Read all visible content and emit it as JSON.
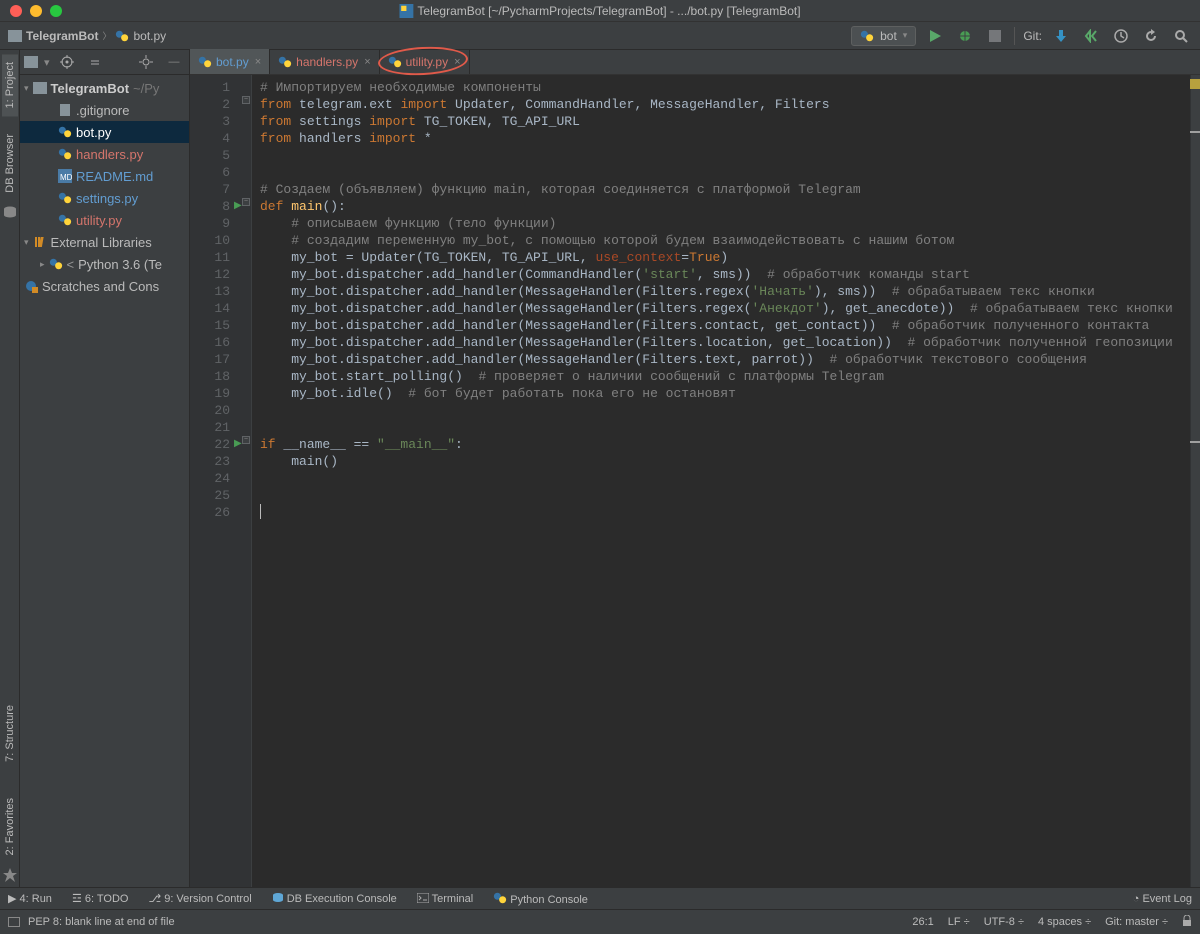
{
  "window": {
    "title": "TelegramBot [~/PycharmProjects/TelegramBot] - .../bot.py [TelegramBot]"
  },
  "breadcrumbs": {
    "project": "TelegramBot",
    "file": "bot.py"
  },
  "toolbar": {
    "run_config": "bot",
    "git_label": "Git:"
  },
  "left_gutter": {
    "tab_project": "1: Project",
    "tab_db_browser": "DB Browser",
    "tab_structure": "7: Structure",
    "tab_favorites": "2: Favorites"
  },
  "project_panel": {
    "header_icon_tip": "Project",
    "root_name": "TelegramBot",
    "root_path": "~/Py",
    "files": [
      {
        "name": ".gitignore",
        "type": "file",
        "modified": false
      },
      {
        "name": "bot.py",
        "type": "py",
        "modified": true,
        "selected": true
      },
      {
        "name": "handlers.py",
        "type": "py",
        "conflict": true
      },
      {
        "name": "README.md",
        "type": "md",
        "modified": true
      },
      {
        "name": "settings.py",
        "type": "py",
        "modified": true
      },
      {
        "name": "utility.py",
        "type": "py",
        "conflict": true
      }
    ],
    "external_libs": "External Libraries",
    "python_env": "Python 3.6 (Te",
    "scratches": "Scratches and Cons"
  },
  "editor_tabs": [
    {
      "name": "bot.py",
      "modified": true,
      "active": true
    },
    {
      "name": "handlers.py",
      "conflict": true
    },
    {
      "name": "utility.py",
      "conflict": true
    }
  ],
  "code": {
    "lines": [
      {
        "n": 1,
        "html": "<span class='c-cm'># Импортируем необходимые компоненты</span>"
      },
      {
        "n": 2,
        "html": "<span class='c-kw'>from</span> telegram.ext <span class='c-kw'>import</span> Updater, CommandHandler, MessageHandler, Filters"
      },
      {
        "n": 3,
        "html": "<span class='c-kw'>from</span> settings <span class='c-kw'>import</span> TG_TOKEN, TG_API_URL"
      },
      {
        "n": 4,
        "html": "<span class='c-kw'>from</span> handlers <span class='c-kw'>import</span> *"
      },
      {
        "n": 5,
        "html": ""
      },
      {
        "n": 6,
        "html": ""
      },
      {
        "n": 7,
        "html": "<span class='c-cm'># Создаем (объявляем) функцию main, которая соединяется с платформой Telegram</span>"
      },
      {
        "n": 8,
        "html": "<span class='c-kw'>def</span> <span class='c-fn'>main</span>():",
        "run": true
      },
      {
        "n": 9,
        "html": "    <span class='c-cm'># описываем функцию (тело функции)</span>"
      },
      {
        "n": 10,
        "html": "    <span class='c-cm'># создадим переменную my_bot, с помощью которой будем взаимодействовать с нашим ботом</span>"
      },
      {
        "n": 11,
        "html": "    my_bot = Updater(TG_TOKEN, TG_API_URL, <span class='c-par'>use_context</span>=<span class='c-kw'>True</span>)"
      },
      {
        "n": 12,
        "html": "    my_bot.dispatcher.add_handler(CommandHandler(<span class='c-str'>'start'</span>, sms))  <span class='c-cm'># обработчик команды start</span>"
      },
      {
        "n": 13,
        "html": "    my_bot.dispatcher.add_handler(MessageHandler(Filters.regex(<span class='c-str'>'Начать'</span>), sms))  <span class='c-cm'># обрабатываем текс кнопки</span>"
      },
      {
        "n": 14,
        "html": "    my_bot.dispatcher.add_handler(MessageHandler(Filters.regex(<span class='c-str'>'Анекдот'</span>), get_anecdote))  <span class='c-cm'># обрабатываем текс кнопки</span>"
      },
      {
        "n": 15,
        "html": "    my_bot.dispatcher.add_handler(MessageHandler(Filters.contact, get_contact))  <span class='c-cm'># обработчик полученного контакта</span>"
      },
      {
        "n": 16,
        "html": "    my_bot.dispatcher.add_handler(MessageHandler(Filters.location, get_location))  <span class='c-cm'># обработчик полученной геопозиции</span>"
      },
      {
        "n": 17,
        "html": "    my_bot.dispatcher.add_handler(MessageHandler(Filters.text, parrot))  <span class='c-cm'># обработчик текстового сообщения</span>"
      },
      {
        "n": 18,
        "html": "    my_bot.start_polling()  <span class='c-cm'># проверяет о наличии сообщений с платформы Telegram</span>"
      },
      {
        "n": 19,
        "html": "    my_bot.idle()  <span class='c-cm'># бот будет работать пока его не остановят</span>"
      },
      {
        "n": 20,
        "html": ""
      },
      {
        "n": 21,
        "html": ""
      },
      {
        "n": 22,
        "html": "<span class='c-kw'>if</span> __name__ == <span class='c-str'>\"__main__\"</span>:",
        "run": true
      },
      {
        "n": 23,
        "html": "    main()"
      },
      {
        "n": 24,
        "html": ""
      },
      {
        "n": 25,
        "html": ""
      },
      {
        "n": 26,
        "html": ""
      }
    ]
  },
  "bottom_tabs": {
    "run": "4: Run",
    "todo": "6: TODO",
    "vcs": "9: Version Control",
    "db": "DB Execution Console",
    "terminal": "Terminal",
    "python_console": "Python Console",
    "event_log": "Event Log"
  },
  "status": {
    "message": "PEP 8: blank line at end of file",
    "position": "26:1",
    "line_sep": "LF",
    "encoding": "UTF-8",
    "indent": "4 spaces",
    "git_branch": "Git: master",
    "lock_icon": "lock"
  }
}
